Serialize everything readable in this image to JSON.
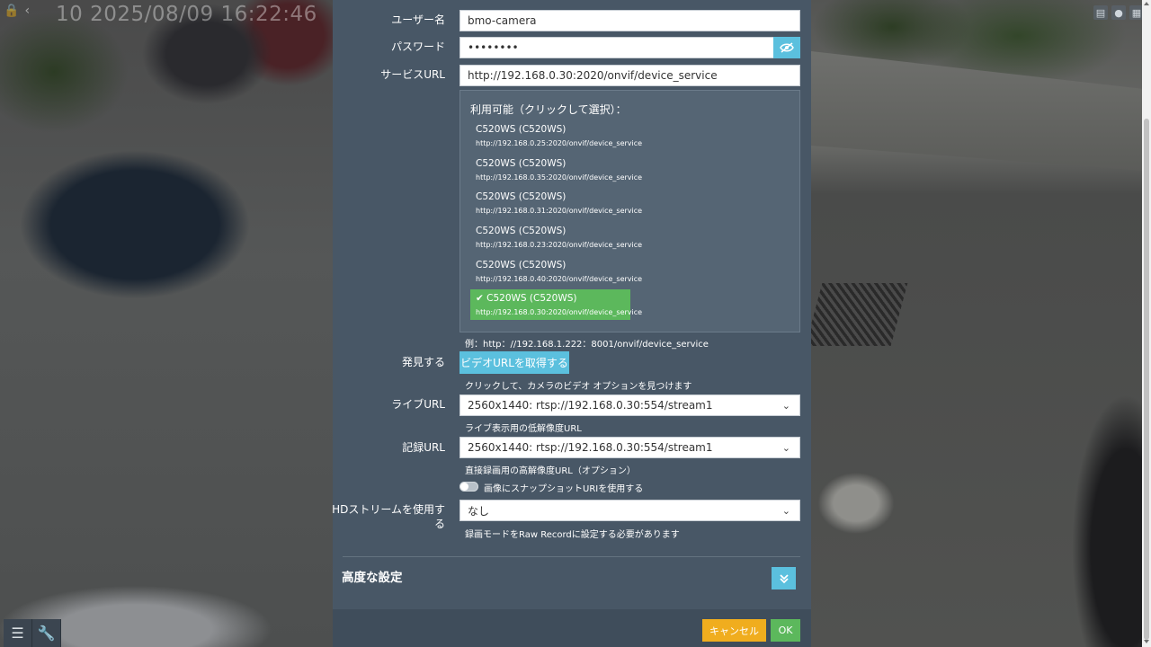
{
  "camera": {
    "timestamp": "10 2025/08/09 16:22:46",
    "lock_icon": "lock-icon",
    "back_icon": "chevron-left-icon"
  },
  "form": {
    "username": {
      "label": "ユーザー名",
      "value": "bmo-camera"
    },
    "password": {
      "label": "パスワード",
      "value": "••••••••",
      "toggle_icon": "eye-slash-icon"
    },
    "service_url": {
      "label": "サービスURL",
      "value": "http://192.168.0.30:2020/onvif/device_service"
    },
    "devices": {
      "title": "利用可能（クリックして選択）：",
      "items": [
        {
          "name": "C520WS (C520WS)",
          "url": "http://192.168.0.25:2020/onvif/device_service",
          "selected": false
        },
        {
          "name": "C520WS (C520WS)",
          "url": "http://192.168.0.35:2020/onvif/device_service",
          "selected": false
        },
        {
          "name": "C520WS (C520WS)",
          "url": "http://192.168.0.31:2020/onvif/device_service",
          "selected": false
        },
        {
          "name": "C520WS (C520WS)",
          "url": "http://192.168.0.23:2020/onvif/device_service",
          "selected": false
        },
        {
          "name": "C520WS (C520WS)",
          "url": "http://192.168.0.40:2020/onvif/device_service",
          "selected": false
        },
        {
          "name": "✔ C520WS (C520WS)",
          "url": "http://192.168.0.30:2020/onvif/device_service",
          "selected": true
        }
      ]
    },
    "example": "例：http：//192.168.1.222：8001/onvif/device_service",
    "discover": {
      "label": "発見する",
      "button": "ビデオURLを取得する",
      "help": "クリックして、カメラのビデオ オプションを見つけます"
    },
    "live_url": {
      "label": "ライブURL",
      "value": "2560x1440: rtsp://192.168.0.30:554/stream1",
      "help": "ライブ表示用の低解像度URL"
    },
    "record_url": {
      "label": "記録URL",
      "value": "2560x1440: rtsp://192.168.0.30:554/stream1",
      "help": "直接録画用の高解像度URL（オプション）"
    },
    "snapshot_toggle": {
      "label": "画像にスナップショットURIを使用する",
      "on": false
    },
    "hd_stream": {
      "label_line1": "HDストリームを使用す",
      "label_line2": "る",
      "value": "なし",
      "help": "録画モードをRaw Recordに設定する必要があります"
    },
    "advanced": {
      "title": "高度な設定",
      "icon": "double-chevron-down-icon"
    }
  },
  "footer": {
    "cancel": "キャンセル",
    "ok": "OK"
  },
  "colors": {
    "panel": "#485766",
    "info": "#5bc0de",
    "success": "#5cb85c",
    "warning": "#f0ad1e"
  }
}
